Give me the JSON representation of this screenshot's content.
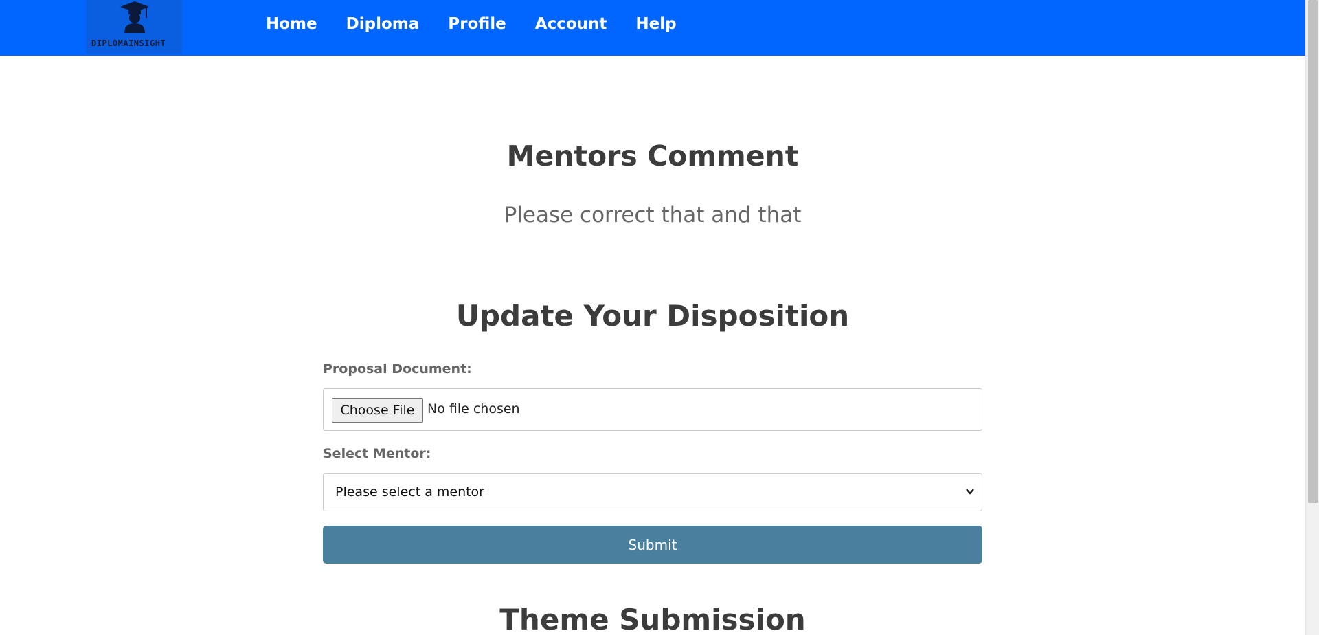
{
  "nav": {
    "logo_text": "DIPLOMAINSIGHT",
    "links": [
      "Home",
      "Diploma",
      "Profile",
      "Account",
      "Help"
    ]
  },
  "mentors_comment": {
    "heading": "Mentors Comment",
    "text": "Please correct that and that"
  },
  "update_form": {
    "heading": "Update Your Disposition",
    "proposal_label": "Proposal Document:",
    "choose_file_label": "Choose File",
    "file_status": "No file chosen",
    "mentor_label": "Select Mentor:",
    "mentor_selected": "Please select a mentor",
    "submit_label": "Submit"
  },
  "next_section": {
    "heading": "Theme Submission"
  },
  "colors": {
    "navbar": "#0066ff",
    "submit": "#4a7f9e"
  },
  "icons": {
    "logo": "graduate-cap-icon",
    "select_arrow": "chevron-down-icon"
  }
}
